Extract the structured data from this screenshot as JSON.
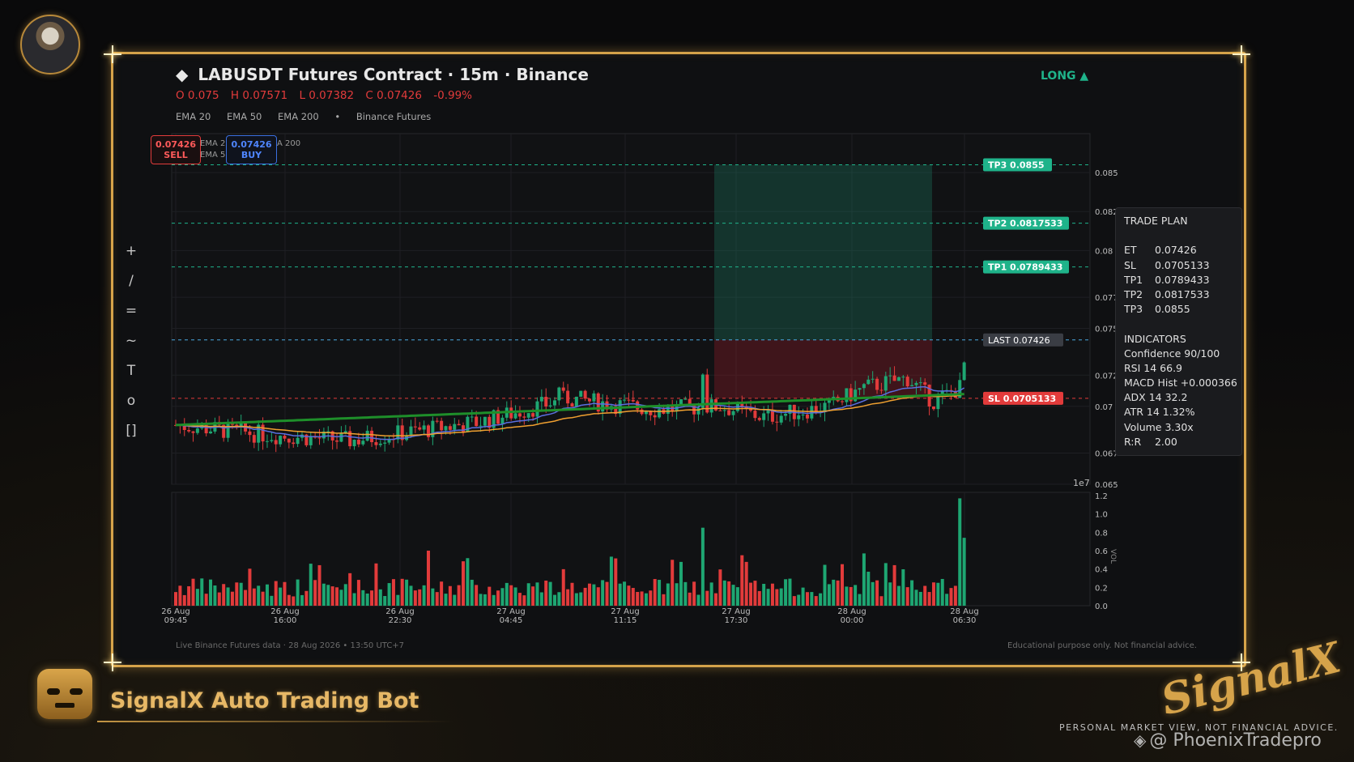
{
  "header": {
    "title": "LABUSDT Futures Contract  ·  15m  ·  Binance",
    "direction": "LONG ▲",
    "ohlc": {
      "open": "O 0.075",
      "high": "H 0.07571",
      "low": "L 0.07382",
      "close": "C 0.07426",
      "change": "-0.99%"
    },
    "ema_legend": [
      "EMA 20",
      "EMA 50",
      "EMA 200",
      "•",
      "Binance Futures"
    ]
  },
  "orders": {
    "sell_price": "0.07426",
    "sell_label": "SELL",
    "buy_price": "0.07426",
    "buy_label": "BUY",
    "overlay_legend": "EMA 2…  EMA 5…  …A 200"
  },
  "toolbar": [
    "+",
    "/",
    "=",
    "~",
    "T",
    "o",
    "[]"
  ],
  "levels": {
    "tp3": "TP3  0.0855",
    "tp2": "TP2  0.0817533",
    "tp1": "TP1  0.0789433",
    "last": "LAST  0.07426",
    "sl": "SL  0.0705133"
  },
  "chart_data": {
    "type": "candlestick",
    "title": "LABUSDT Futures Contract · 15m · Binance",
    "y_ticks": [
      "0.085",
      "0.0825",
      "0.08",
      "0.077",
      "0.075",
      "0.072",
      "0.07",
      "0.067",
      "0.065"
    ],
    "y_range": [
      0.065,
      0.0875
    ],
    "x_ticks": [
      "26 Aug\n09:45",
      "26 Aug\n16:00",
      "26 Aug\n22:30",
      "27 Aug\n04:45",
      "27 Aug\n11:15",
      "27 Aug\n17:30",
      "28 Aug\n00:00",
      "28 Aug\n06:30"
    ],
    "exponent_label": "1e7",
    "volume_axis_label": "VOL",
    "volume_ticks": [
      "0.0",
      "0.2",
      "0.4",
      "0.6",
      "0.8",
      "1.0",
      "1.2"
    ],
    "levels": {
      "TP3": 0.0855,
      "TP2": 0.0817533,
      "TP1": 0.0789433,
      "LAST": 0.07426,
      "SL": 0.0705133
    },
    "ema_colors": {
      "ema20": "#5a6fe0",
      "ema50": "#f0a030",
      "ema200": "#1e8f2a"
    },
    "up_color": "#1ea672",
    "down_color": "#e23b3b"
  },
  "trade_plan": {
    "title": "TRADE PLAN",
    "rows": [
      {
        "k": "ET",
        "v": "0.07426"
      },
      {
        "k": "SL",
        "v": "0.0705133"
      },
      {
        "k": "TP1",
        "v": "0.0789433"
      },
      {
        "k": "TP2",
        "v": "0.0817533"
      },
      {
        "k": "TP3",
        "v": "0.0855"
      }
    ],
    "indicators_title": "INDICATORS",
    "indicators": [
      {
        "k": "Confidence",
        "v": "90/100"
      },
      {
        "k": "RSI 14",
        "v": "66.9"
      },
      {
        "k": "MACD Hist",
        "v": "+0.000366"
      },
      {
        "k": "ADX 14",
        "v": "32.2"
      },
      {
        "k": "ATR 14",
        "v": "1.32%"
      },
      {
        "k": "Volume",
        "v": "3.30x"
      },
      {
        "k": "R:R",
        "v": "2.00"
      }
    ]
  },
  "footer": {
    "left": "Live Binance Futures data  ·  28 Aug 2026 • 13:50 UTC+7",
    "right": "Educational purpose only. Not financial advice."
  },
  "branding": {
    "bot_name": "SignalX Auto Trading Bot",
    "logo": "SignalX",
    "tagline": "PERSONAL MARKET VIEW, NOT FINANCIAL ADVICE.",
    "watermark": "@ PhoenixTradepro"
  },
  "colors": {
    "gold": "#d6a34a",
    "tp": "#1fb38a",
    "sl": "#e23b3b",
    "last": "#4aa8e0"
  }
}
